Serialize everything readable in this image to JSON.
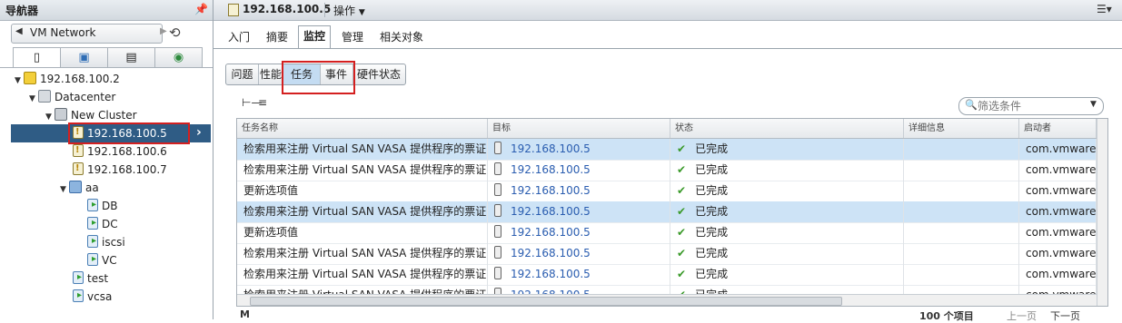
{
  "navigator": {
    "title": "导航器",
    "back_label": "VM Network",
    "tree": [
      {
        "label": "192.168.100.2",
        "icon": "vcenter-icon"
      },
      {
        "label": "Datacenter",
        "icon": "datacenter-icon"
      },
      {
        "label": "New Cluster",
        "icon": "cluster-icon"
      },
      {
        "label": "192.168.100.5",
        "icon": "host-warning-icon"
      },
      {
        "label": "192.168.100.6",
        "icon": "host-warning-icon"
      },
      {
        "label": "192.168.100.7",
        "icon": "host-warning-icon"
      },
      {
        "label": "aa",
        "icon": "vapp-icon"
      },
      {
        "label": "DB",
        "icon": "vm-icon"
      },
      {
        "label": "DC",
        "icon": "vm-icon"
      },
      {
        "label": "iscsi",
        "icon": "vm-icon"
      },
      {
        "label": "VC",
        "icon": "vm-icon"
      },
      {
        "label": "test",
        "icon": "vm-icon"
      },
      {
        "label": "vcsa",
        "icon": "vm-icon"
      }
    ]
  },
  "header": {
    "object_title": "192.168.100.5",
    "actions_label": "操作"
  },
  "tabs": [
    "入门",
    "摘要",
    "监控",
    "管理",
    "相关对象"
  ],
  "subtabs": [
    "问题",
    "性能",
    "任务",
    "事件",
    "硬件状态"
  ],
  "filter": {
    "placeholder": "筛选条件"
  },
  "grid": {
    "columns": [
      "任务名称",
      "目标",
      "状态",
      "详细信息",
      "启动者"
    ],
    "rows": [
      {
        "task": "检索用来注册 Virtual SAN VASA 提供程序的票证",
        "target": "192.168.100.5",
        "status": "已完成",
        "details": "",
        "initiator": "com.vmware."
      },
      {
        "task": "检索用来注册 Virtual SAN VASA 提供程序的票证",
        "target": "192.168.100.5",
        "status": "已完成",
        "details": "",
        "initiator": "com.vmware."
      },
      {
        "task": "更新选项值",
        "target": "192.168.100.5",
        "status": "已完成",
        "details": "",
        "initiator": "com.vmware."
      },
      {
        "task": "检索用来注册 Virtual SAN VASA 提供程序的票证",
        "target": "192.168.100.5",
        "status": "已完成",
        "details": "",
        "initiator": "com.vmware."
      },
      {
        "task": "更新选项值",
        "target": "192.168.100.5",
        "status": "已完成",
        "details": "",
        "initiator": "com.vmware."
      },
      {
        "task": "检索用来注册 Virtual SAN VASA 提供程序的票证",
        "target": "192.168.100.5",
        "status": "已完成",
        "details": "",
        "initiator": "com.vmware."
      },
      {
        "task": "检索用来注册 Virtual SAN VASA 提供程序的票证",
        "target": "192.168.100.5",
        "status": "已完成",
        "details": "",
        "initiator": "com.vmware."
      },
      {
        "task": "检索用来注册 Virtual SAN VASA 提供程序的票证",
        "target": "192.168.100.5",
        "status": "已完成",
        "details": "",
        "initiator": "com.vmware."
      }
    ]
  },
  "footer": {
    "count": "100 个项目",
    "prev": "上一页",
    "next": "下一页"
  }
}
